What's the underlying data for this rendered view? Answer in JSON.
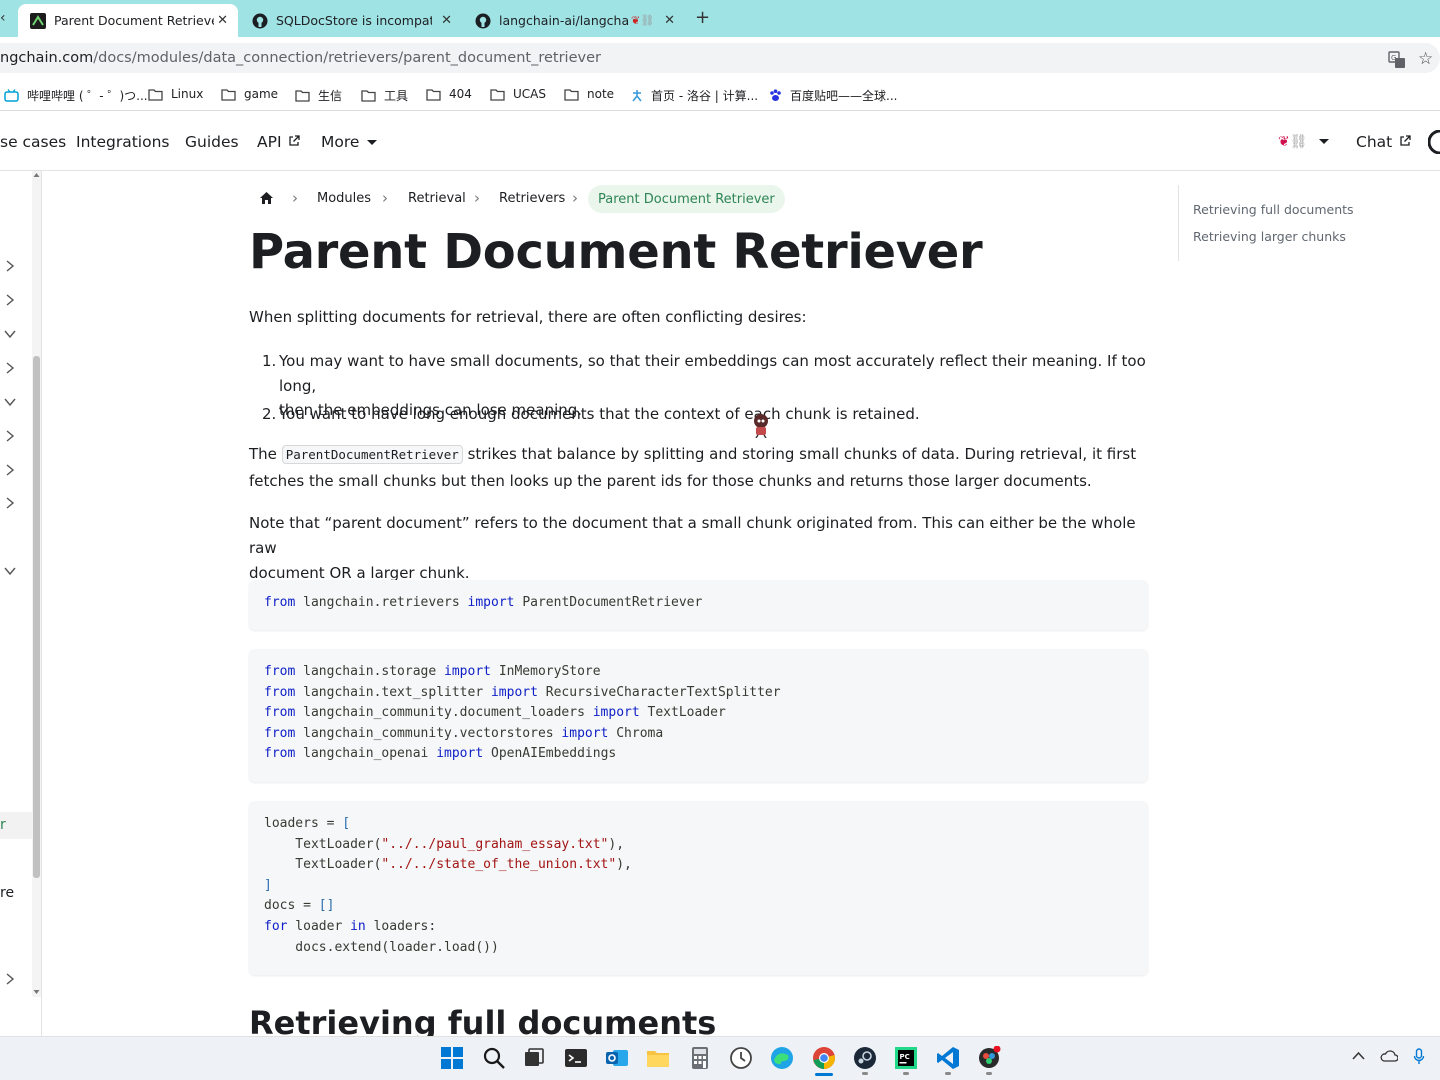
{
  "browser": {
    "tabs": [
      {
        "title": "Parent Document Retriever |",
        "active": true
      },
      {
        "title": "SQLDocStore is incompatible",
        "active": false
      },
      {
        "title": "langchain-ai/langchain:",
        "active": false
      }
    ],
    "url_host": "ngchain.com",
    "url_path": "/docs/modules/data_connection/retrievers/parent_document_retriever",
    "bookmarks": [
      "哔哩哔哩 ( ゜- ゜)つ...",
      "Linux",
      "game",
      "生信",
      "工具",
      "404",
      "UCAS",
      "note",
      "首页 - 洛谷 | 计算...",
      "百度贴吧——全球..."
    ]
  },
  "navbar": {
    "items": [
      "se cases",
      "Integrations",
      "Guides",
      "API",
      "More"
    ],
    "chat": "Chat"
  },
  "sidebar": {
    "partial_labels": [
      "r",
      "re"
    ]
  },
  "breadcrumb": {
    "items": [
      "Modules",
      "Retrieval",
      "Retrievers"
    ],
    "active": "Parent Document Retriever"
  },
  "article": {
    "title": "Parent Document Retriever",
    "intro": "When splitting documents for retrieval, there are often conflicting desires:",
    "list": [
      {
        "num": "1.",
        "line1": "You may want to have small documents, so that their embeddings can most accurately reflect their meaning. If too long,",
        "line2": "then the embeddings can lose meaning."
      },
      {
        "num": "2.",
        "line1": "You want to have long enough documents that the context of each chunk is retained."
      }
    ],
    "p2_before": "The",
    "p2_code": "ParentDocumentRetriever",
    "p2_after": "strikes that balance by splitting and storing small chunks of data. During retrieval, it first",
    "p2_line2": "fetches the small chunks but then looks up the parent ids for those chunks and returns those larger documents.",
    "p3_line1": "Note that “parent document” refers to the document that a small chunk originated from. This can either be the whole raw",
    "p3_line2": "document OR a larger chunk.",
    "h2": "Retrieving full documents"
  },
  "code": {
    "block1": [
      {
        "kw1": "from",
        "mod": "langchain.retrievers",
        "kw2": "import",
        "name": "ParentDocumentRetriever"
      }
    ],
    "block2": [
      {
        "kw1": "from",
        "mod": "langchain.storage",
        "kw2": "import",
        "name": "InMemoryStore"
      },
      {
        "kw1": "from",
        "mod": "langchain.text_splitter",
        "kw2": "import",
        "name": "RecursiveCharacterTextSplitter"
      },
      {
        "kw1": "from",
        "mod": "langchain_community.document_loaders",
        "kw2": "import",
        "name": "TextLoader"
      },
      {
        "kw1": "from",
        "mod": "langchain_community.vectorstores",
        "kw2": "import",
        "name": "Chroma"
      },
      {
        "kw1": "from",
        "mod": "langchain_openai",
        "kw2": "import",
        "name": "OpenAIEmbeddings"
      }
    ],
    "block3": {
      "l1": "loaders = ",
      "l2_fn": "    TextLoader(",
      "l2_str": "\"../../paul_graham_essay.txt\"",
      "l3_fn": "    TextLoader(",
      "l3_str": "\"../../state_of_the_union.txt\"",
      "l5": "docs = ",
      "l6_kw": "for",
      "l6_mid": " loader ",
      "l6_kw2": "in",
      "l6_end": " loaders:",
      "l7": "    docs.extend(loader.load())"
    }
  },
  "toc": {
    "items": [
      "Retrieving full documents",
      "Retrieving larger chunks"
    ]
  },
  "colors": {
    "tab_strip": "#9fe3e5",
    "breadcrumb_active_bg": "#eaf5ec",
    "breadcrumb_active_text": "#2e8555",
    "code_keyword": "#0e1fc7",
    "code_string": "#a31515"
  }
}
